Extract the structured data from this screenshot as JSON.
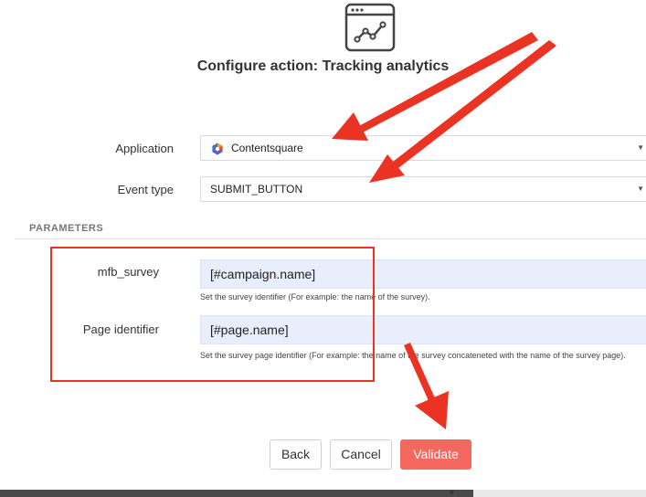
{
  "dialog": {
    "title": "Configure action: Tracking analytics",
    "icon": "analytics-chart-icon"
  },
  "form": {
    "application": {
      "label": "Application",
      "value": "Contentsquare",
      "icon": "contentsquare-logo-icon"
    },
    "event_type": {
      "label": "Event type",
      "value": "SUBMIT_BUTTON"
    }
  },
  "parameters": {
    "section_title": "PARAMETERS",
    "items": [
      {
        "label": "mfb_survey",
        "value": "[#campaign.name]",
        "help": "Set the survey identifier (For example: the name of the survey)."
      },
      {
        "label": "Page identifier",
        "value": "[#page.name]",
        "help": "Set the survey page identifier (For example: the name of the survey concateneted with the name of the survey page)."
      }
    ]
  },
  "footer": {
    "back_label": "Back",
    "cancel_label": "Cancel",
    "validate_label": "Validate"
  },
  "colors": {
    "accent": "#f4685d",
    "annotation_red": "#ea3323",
    "input_bg": "#e8eefb"
  }
}
